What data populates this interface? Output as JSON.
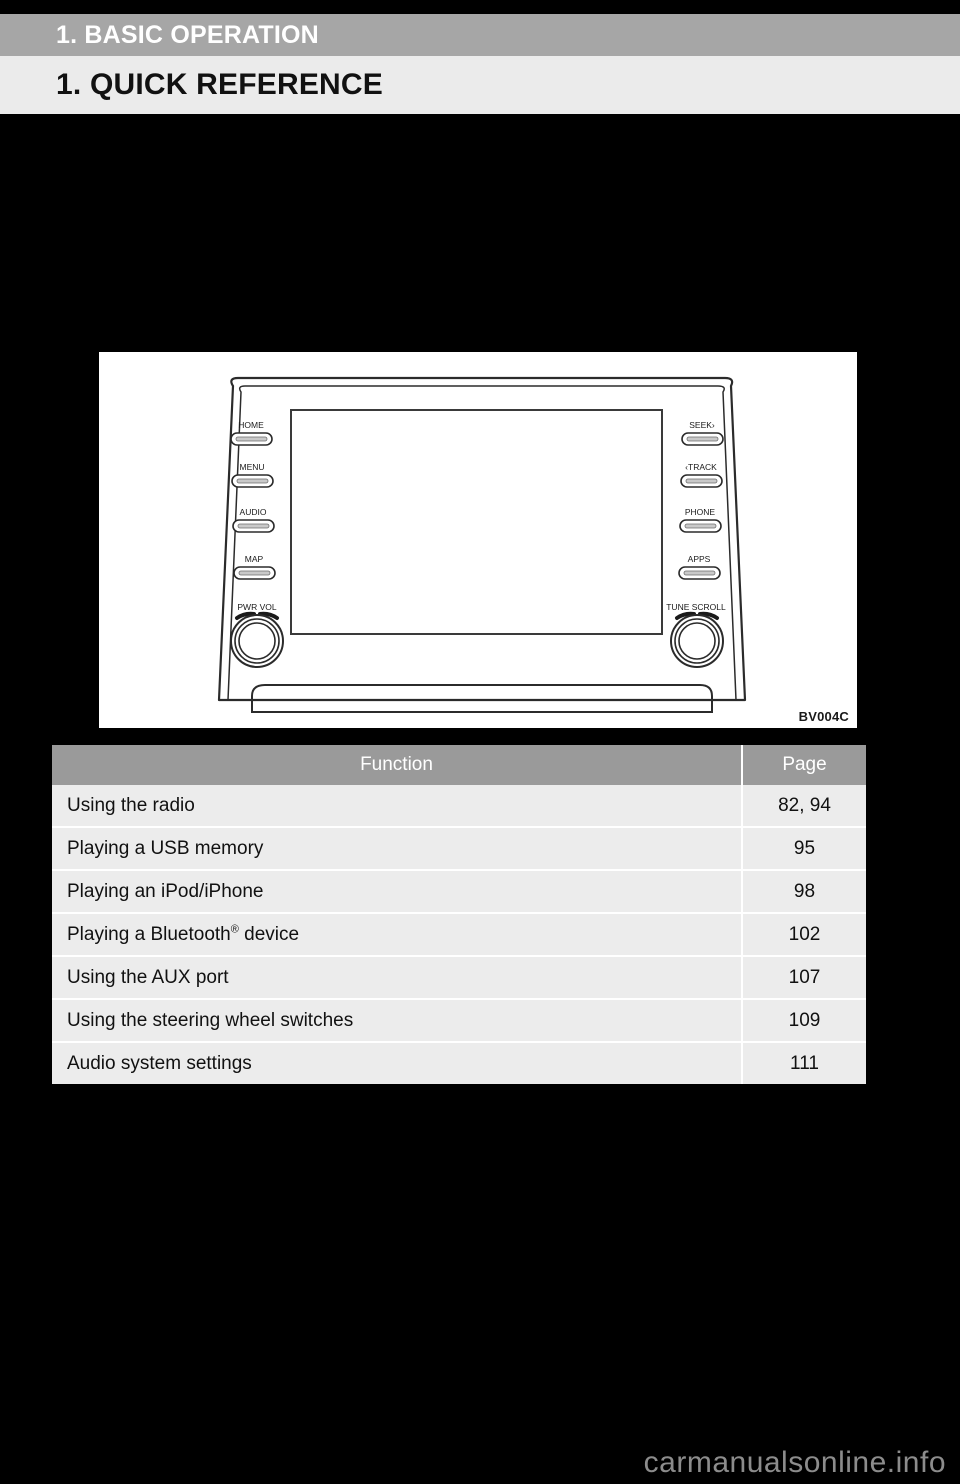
{
  "header": {
    "chapter": "1. BASIC OPERATION",
    "section": "1. QUICK REFERENCE"
  },
  "illustration": {
    "figure_code": "BV004C",
    "left_buttons": [
      {
        "label": "HOME"
      },
      {
        "label": "MENU"
      },
      {
        "label": "AUDIO"
      },
      {
        "label": "MAP"
      }
    ],
    "right_buttons": [
      {
        "label": "SEEK›"
      },
      {
        "label": "‹TRACK"
      },
      {
        "label": "PHONE"
      },
      {
        "label": "APPS"
      }
    ],
    "left_knob_label": "PWR VOL",
    "right_knob_label": "TUNE SCROLL"
  },
  "table": {
    "columns": [
      "Function",
      "Page"
    ],
    "rows": [
      {
        "function": "Using the radio",
        "function_sup": "",
        "function_tail": "",
        "page": "82, 94"
      },
      {
        "function": "Playing a USB memory",
        "function_sup": "",
        "function_tail": "",
        "page": "95"
      },
      {
        "function": "Playing an iPod/iPhone",
        "function_sup": "",
        "function_tail": "",
        "page": "98"
      },
      {
        "function": "Playing a Bluetooth",
        "function_sup": "®",
        "function_tail": " device",
        "page": "102"
      },
      {
        "function": "Using the AUX port",
        "function_sup": "",
        "function_tail": "",
        "page": "107"
      },
      {
        "function": "Using the steering wheel switches",
        "function_sup": "",
        "function_tail": "",
        "page": "109"
      },
      {
        "function": "Audio system settings",
        "function_sup": "",
        "function_tail": "",
        "page": "111"
      }
    ]
  },
  "footer": {
    "watermark": "carmanualsonline.info"
  },
  "colors": {
    "page_background": "#000000",
    "chapter_bar": "#a6a6a6",
    "section_bar": "#ebebeb",
    "table_header": "#9a9a9a",
    "table_row": "#ececec",
    "illustration_background": "#ffffff",
    "watermark": "#8c8c8c"
  }
}
